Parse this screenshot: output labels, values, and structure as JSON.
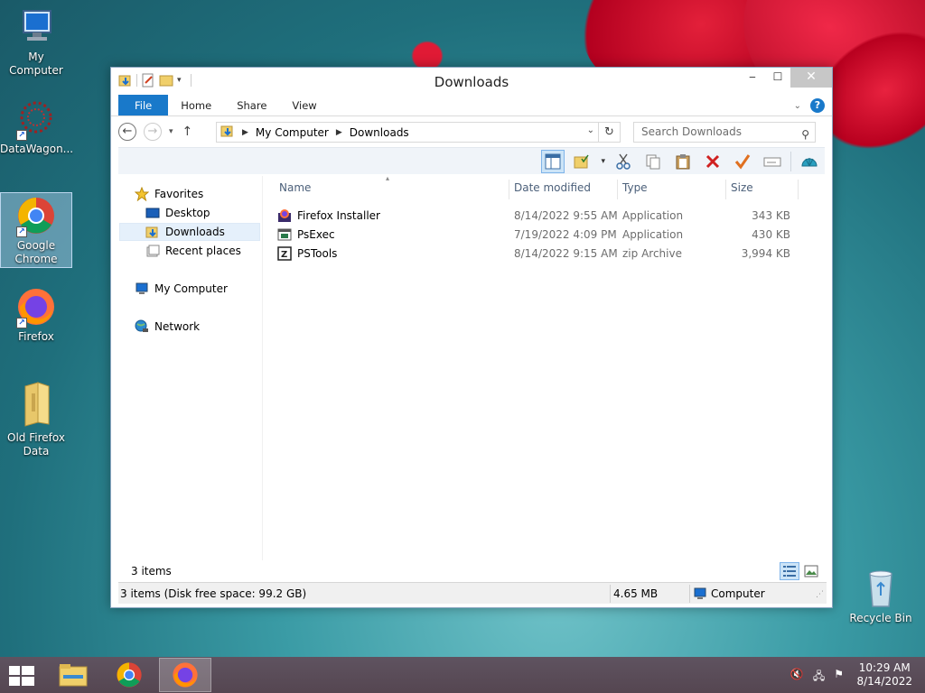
{
  "desktop": {
    "icons": [
      {
        "label": "My Computer",
        "icon": "computer-icon"
      },
      {
        "label": "DataWagon...",
        "icon": "datawagon-icon"
      },
      {
        "label": "Google Chrome",
        "icon": "chrome-icon"
      },
      {
        "label": "Firefox",
        "icon": "firefox-icon"
      },
      {
        "label": "Old Firefox Data",
        "icon": "folder-icon"
      },
      {
        "label": "Recycle Bin",
        "icon": "recycle-bin-icon"
      }
    ]
  },
  "window": {
    "title": "Downloads",
    "tabs": [
      "File",
      "Home",
      "Share",
      "View"
    ],
    "address": {
      "root": "My Computer",
      "current": "Downloads"
    },
    "search_placeholder": "Search Downloads",
    "nav": {
      "favorites": "Favorites",
      "desktop": "Desktop",
      "downloads": "Downloads",
      "recent": "Recent places",
      "computer": "My Computer",
      "network": "Network"
    },
    "columns": {
      "name": "Name",
      "date": "Date modified",
      "type": "Type",
      "size": "Size"
    },
    "files": [
      {
        "name": "Firefox Installer",
        "date": "8/14/2022 9:55 AM",
        "type": "Application",
        "size": "343 KB",
        "icon": "installer-icon"
      },
      {
        "name": "PsExec",
        "date": "7/19/2022 4:09 PM",
        "type": "Application",
        "size": "430 KB",
        "icon": "app-icon"
      },
      {
        "name": "PSTools",
        "date": "8/14/2022 9:15 AM",
        "type": "zip Archive",
        "size": "3,994 KB",
        "icon": "zip-icon"
      }
    ],
    "status": {
      "count": "3 items",
      "detail": "3 items (Disk free space: 99.2 GB)",
      "size": "4.65 MB",
      "location": "Computer"
    }
  },
  "taskbar": {
    "time": "10:29 AM",
    "date": "8/14/2022"
  },
  "colors": {
    "accent": "#1979ca",
    "selection": "#cce4f7"
  }
}
